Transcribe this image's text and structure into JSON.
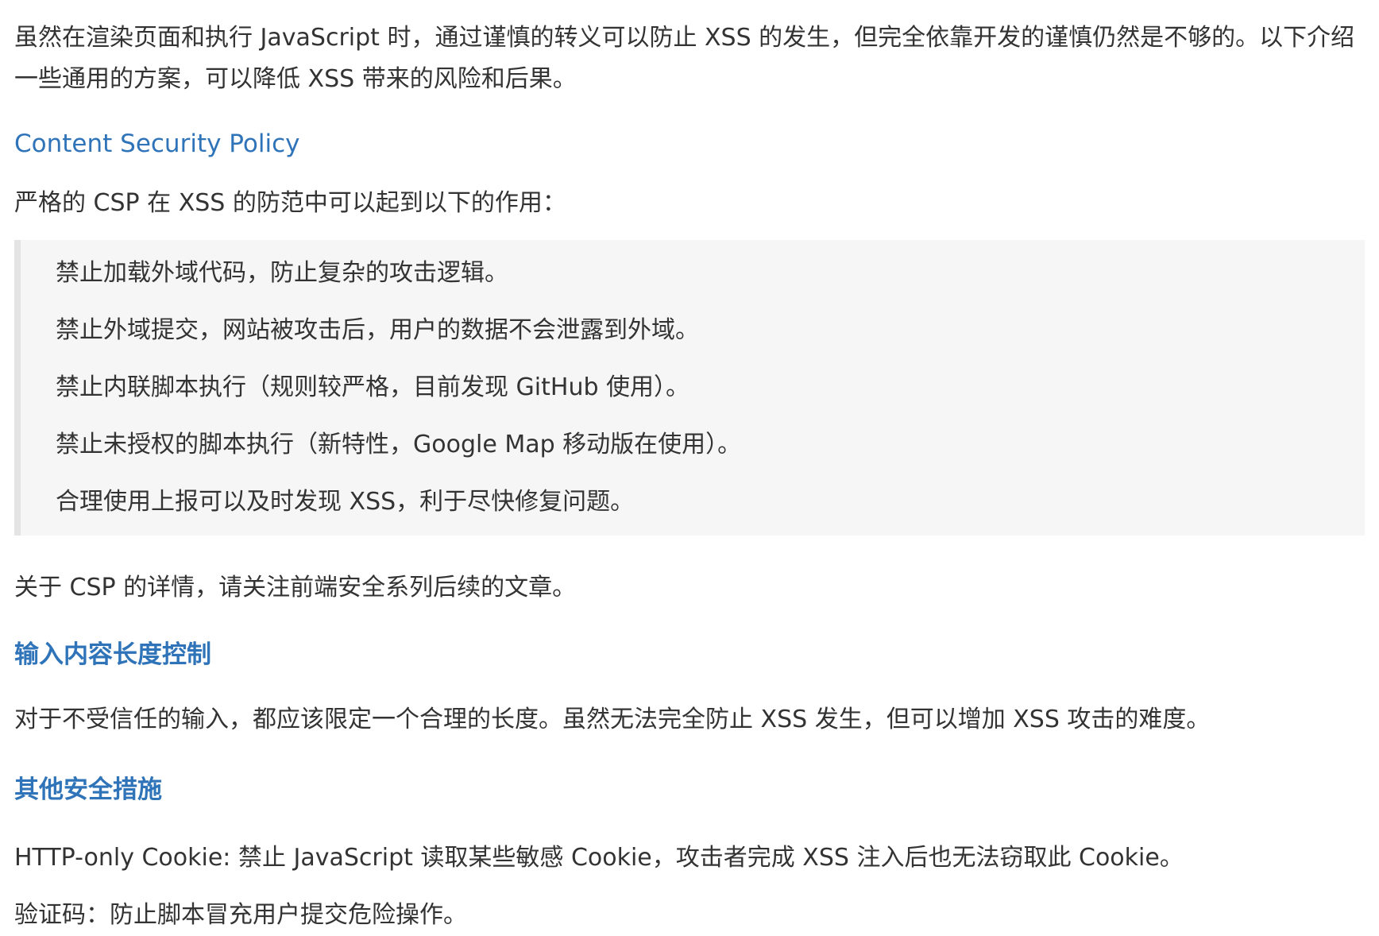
{
  "intro": {
    "line1": "虽然在渲染页面和执行 JavaScript 时，通过谨慎的转义可以防止 XSS 的发生，但完全依靠开发的谨慎仍然是不够的。以下介绍",
    "line2": "一些通用的方案，可以降低 XSS 带来的风险和后果。"
  },
  "csp": {
    "heading": "Content Security Policy",
    "lead": "严格的 CSP 在 XSS 的防范中可以起到以下的作用：",
    "items": [
      "禁止加载外域代码，防止复杂的攻击逻辑。",
      "禁止外域提交，网站被攻击后，用户的数据不会泄露到外域。",
      "禁止内联脚本执行（规则较严格，目前发现 GitHub 使用）。",
      "禁止未授权的脚本执行（新特性，Google Map 移动版在使用）。",
      "合理使用上报可以及时发现 XSS，利于尽快修复问题。"
    ],
    "detail": "关于 CSP 的详情，请关注前端安全系列后续的文章。"
  },
  "input_length": {
    "heading": "输入内容长度控制",
    "text": "对于不受信任的输入，都应该限定一个合理的长度。虽然无法完全防止 XSS 发生，但可以增加 XSS 攻击的难度。"
  },
  "other_measures": {
    "heading": "其他安全措施",
    "httponly": "HTTP-only Cookie: 禁止 JavaScript 读取某些敏感 Cookie，攻击者完成 XSS 注入后也无法窃取此 Cookie。",
    "captcha": "验证码：防止脚本冒充用户提交危险操作。"
  },
  "colors": {
    "heading": "#2f73b8",
    "body_text": "#333333",
    "quote_bg": "#f6f6f6",
    "quote_border": "#e4e4e4"
  }
}
